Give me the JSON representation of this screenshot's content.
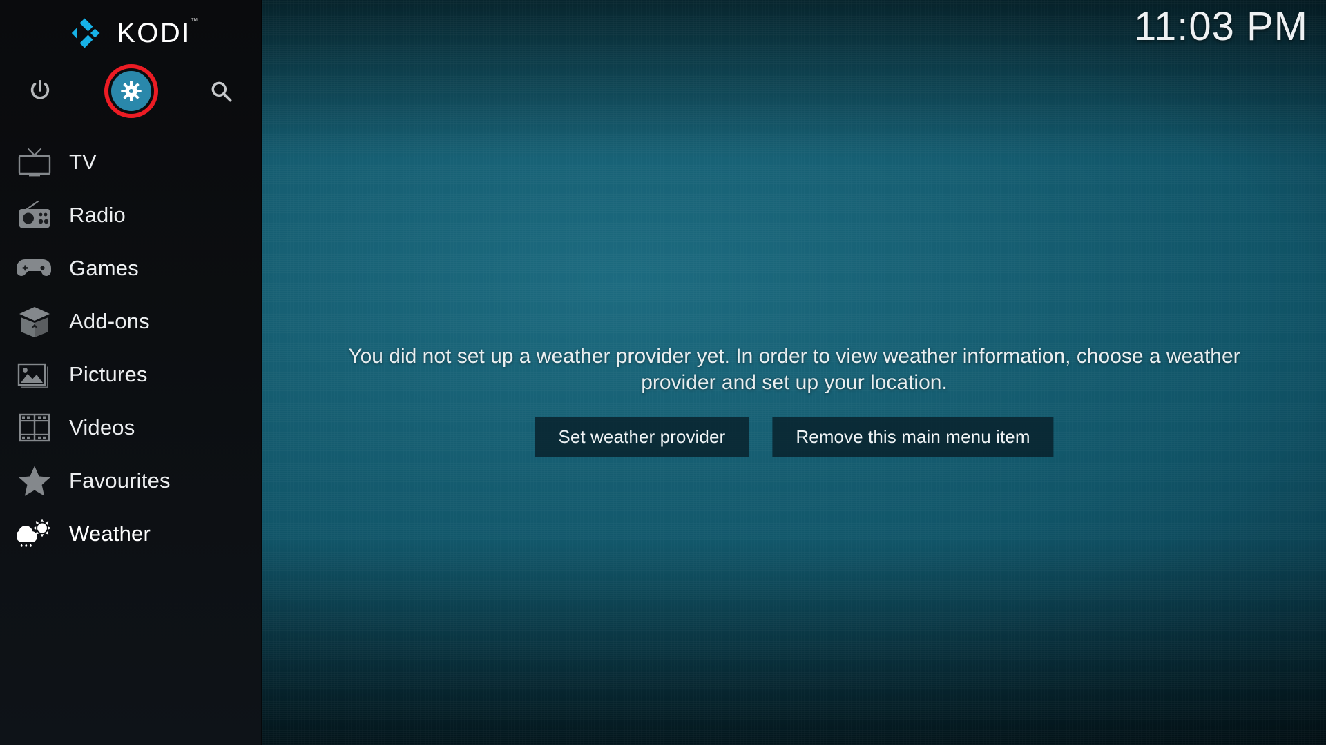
{
  "app": {
    "name": "KODI",
    "logo_icon": "kodi-diamond-logo",
    "trademark": "™",
    "logo_color": "#17b2e7"
  },
  "clock": {
    "time": "11:03 PM"
  },
  "top_actions": [
    {
      "name": "power",
      "icon": "power-icon",
      "label": "Power"
    },
    {
      "name": "settings",
      "icon": "gear-icon",
      "label": "Settings",
      "highlighted": true,
      "highlight_color": "#ec1c24",
      "disc_color": "#2a88ab"
    },
    {
      "name": "search",
      "icon": "search-icon",
      "label": "Search"
    }
  ],
  "sidebar": {
    "items": [
      {
        "label": "TV",
        "icon": "tv-icon",
        "active": false
      },
      {
        "label": "Radio",
        "icon": "radio-icon",
        "active": false
      },
      {
        "label": "Games",
        "icon": "gamepad-icon",
        "active": false
      },
      {
        "label": "Add-ons",
        "icon": "box-icon",
        "active": false
      },
      {
        "label": "Pictures",
        "icon": "picture-icon",
        "active": false
      },
      {
        "label": "Videos",
        "icon": "filmstrip-icon",
        "active": false
      },
      {
        "label": "Favourites",
        "icon": "star-icon",
        "active": false
      },
      {
        "label": "Weather",
        "icon": "weather-icon",
        "active": true
      }
    ]
  },
  "main": {
    "message": "You did not set up a weather provider yet. In order to view weather information, choose a weather provider and set up your location.",
    "buttons": [
      {
        "label": "Set weather provider"
      },
      {
        "label": "Remove this main menu item"
      }
    ]
  },
  "theme": {
    "sidebar_bg": "#0b0d10",
    "content_accent": "#176074",
    "text_primary": "#eef2f4",
    "button_bg": "#081e28"
  }
}
